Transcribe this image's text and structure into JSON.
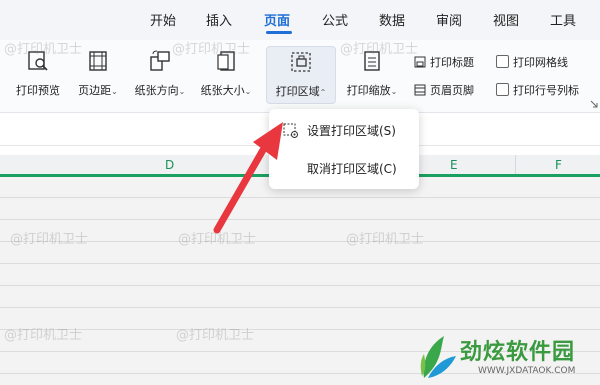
{
  "tabs": [
    {
      "label": "开始",
      "active": false
    },
    {
      "label": "插入",
      "active": false
    },
    {
      "label": "页面",
      "active": true
    },
    {
      "label": "公式",
      "active": false
    },
    {
      "label": "数据",
      "active": false
    },
    {
      "label": "审阅",
      "active": false
    },
    {
      "label": "视图",
      "active": false
    },
    {
      "label": "工具",
      "active": false
    }
  ],
  "ribbon": {
    "print_preview": "打印预览",
    "margins": "页边距",
    "orientation": "纸张方向",
    "paper_size": "纸张大小",
    "print_area": "打印区域",
    "print_scale": "打印缩放",
    "print_titles": "打印标题",
    "header_footer": "页眉页脚",
    "print_gridlines": "打印网格线",
    "print_row_col_headers": "打印行号列标"
  },
  "columns": [
    "D",
    "E",
    "F"
  ],
  "dropdown": {
    "set_print_area": "设置打印区域(S)",
    "clear_print_area": "取消打印区域(C)"
  },
  "watermark": "@打印机卫士",
  "logo": {
    "name": "劲炫软件园",
    "url": "WWW.JXDATAOK.COM"
  },
  "colors": {
    "accent": "#1f6fd6",
    "selection": "#1aa060",
    "column_header_text": "#1a8f5a",
    "arrow": "#e8373f"
  }
}
